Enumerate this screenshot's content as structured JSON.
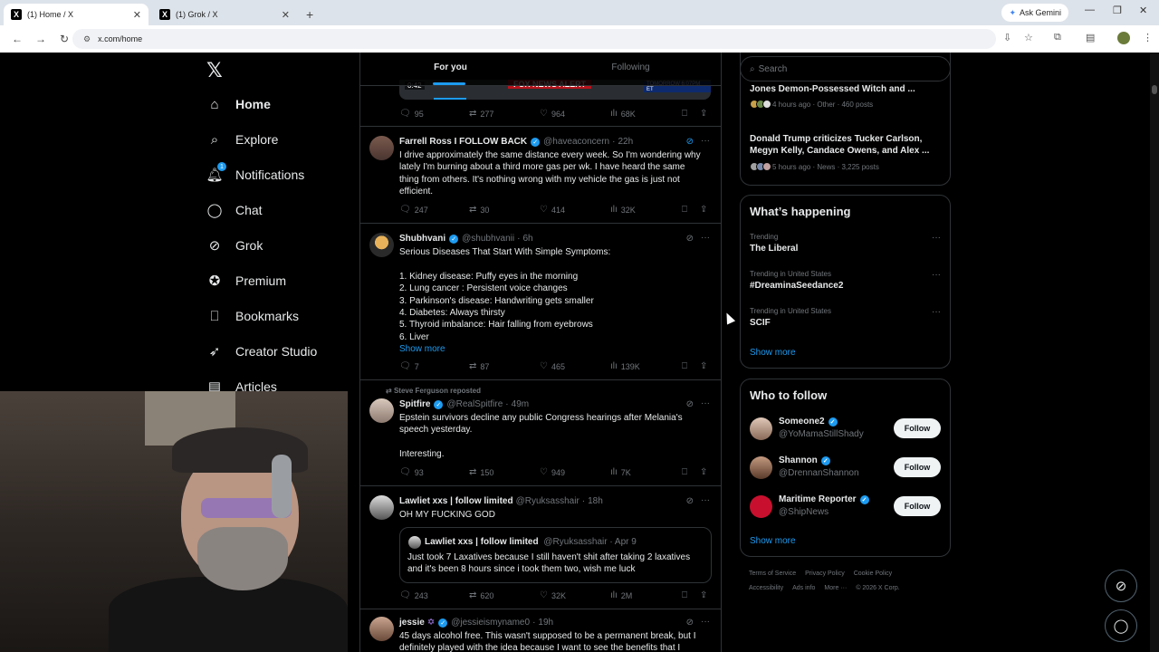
{
  "browser": {
    "tabs": [
      {
        "title": "(1) Home / X"
      },
      {
        "title": "(1) Grok / X"
      }
    ],
    "ask_gemini": "Ask Gemini",
    "url": "x.com/home"
  },
  "sidebar": {
    "items": [
      {
        "label": "Home"
      },
      {
        "label": "Explore"
      },
      {
        "label": "Notifications",
        "badge": "1"
      },
      {
        "label": "Chat"
      },
      {
        "label": "Grok"
      },
      {
        "label": "Premium"
      },
      {
        "label": "Bookmarks"
      },
      {
        "label": "Creator Studio"
      },
      {
        "label": "Articles"
      }
    ]
  },
  "feed": {
    "tabs": [
      {
        "label": "For you"
      },
      {
        "label": "Following"
      }
    ],
    "video": {
      "time": "0:42",
      "alert": "FOX NEWS ALERT",
      "ticker": "TOMORROW 6:07PM ET"
    },
    "top_actions": {
      "replies": "95",
      "reposts": "277",
      "likes": "964",
      "views": "68K"
    },
    "posts": [
      {
        "name": "Farrell Ross I FOLLOW BACK",
        "handle": "@haveaconcern",
        "time": "22h",
        "lines": [
          "I drive approximately the same distance every week. So I'm wondering why",
          "lately I'm burning about a third more gas per wk. I have heard the same",
          "thing from others. It's nothing wrong with my vehicle the gas is just not",
          "efficient."
        ],
        "replies": "247",
        "reposts": "30",
        "likes": "414",
        "views": "32K"
      },
      {
        "name": "Shubhvani",
        "handle": "@shubhvanii",
        "time": "6h",
        "lines": [
          "Serious Diseases That Start With Simple Symptoms:",
          "",
          "1. Kidney disease: Puffy eyes in the morning",
          "2. Lung cancer : Persistent voice changes",
          "3. Parkinson's disease: Handwriting gets smaller",
          "4. Diabetes: Always thirsty",
          "5. Thyroid imbalance: Hair falling from eyebrows",
          "6. Liver"
        ],
        "show_more": "Show more",
        "replies": "7",
        "reposts": "87",
        "likes": "465",
        "views": "139K"
      },
      {
        "repost_by": "Steve Ferguson reposted",
        "name": "Spitfire",
        "handle": "@RealSpitfire",
        "time": "49m",
        "lines": [
          "Epstein survivors decline any public Congress hearings after Melania's",
          "speech yesterday.",
          "",
          "Interesting."
        ],
        "replies": "93",
        "reposts": "150",
        "likes": "949",
        "views": "7K"
      },
      {
        "name": "Lawliet xxs | follow limited",
        "handle": "@Ryuksasshair",
        "time": "18h",
        "lines": [
          "OH MY FUCKING GOD"
        ],
        "quote": {
          "name": "Lawliet xxs | follow limited",
          "handle": "@Ryuksasshair",
          "time": "Apr 9",
          "lines": [
            "Just took 7 Laxatives because I still haven't shit after taking 2 laxatives",
            "and it's been 8 hours since i took them two, wish me luck"
          ]
        },
        "replies": "243",
        "reposts": "620",
        "likes": "32K",
        "views": "2M"
      },
      {
        "name": "jessie",
        "handle": "@jessieismyname0",
        "time": "19h",
        "lines": [
          "45 days alcohol free. This wasn't supposed to be a permanent break, but I",
          "definitely played with the idea because I want to see the benefits that I"
        ]
      }
    ]
  },
  "right": {
    "search_placeholder": "Search",
    "news": [
      {
        "title": "Jones Demon-Possessed Witch and ...",
        "meta": "4 hours ago · Other · 460 posts"
      },
      {
        "title": "Donald Trump criticizes Tucker Carlson, Megyn Kelly, Candace Owens, and Alex ...",
        "meta": "5 hours ago · News · 3,225 posts"
      }
    ],
    "happening": {
      "title": "What’s happening",
      "trends": [
        {
          "meta": "Trending",
          "name": "The Liberal"
        },
        {
          "meta": "Trending in United States",
          "name": "#DreaminaSeedance2"
        },
        {
          "meta": "Trending in United States",
          "name": "SCIF"
        }
      ],
      "show_more": "Show more"
    },
    "who_to_follow": {
      "title": "Who to follow",
      "accounts": [
        {
          "name": "Someone2",
          "handle": "@YoMamaStillShady",
          "button": "Follow"
        },
        {
          "name": "Shannon",
          "handle": "@DrennanShannon",
          "button": "Follow"
        },
        {
          "name": "Maritime Reporter",
          "handle": "@ShipNews",
          "button": "Follow"
        }
      ],
      "show_more": "Show more"
    },
    "footer": [
      "Terms of Service",
      "Privacy Policy",
      "Cookie Policy",
      "Accessibility",
      "Ads info",
      "More ···",
      "© 2026 X Corp."
    ]
  },
  "colors": {
    "accent": "#1d9bf0",
    "background": "#000000",
    "text": "#e7e9ea",
    "muted": "#71767b",
    "border": "#2f3336"
  }
}
